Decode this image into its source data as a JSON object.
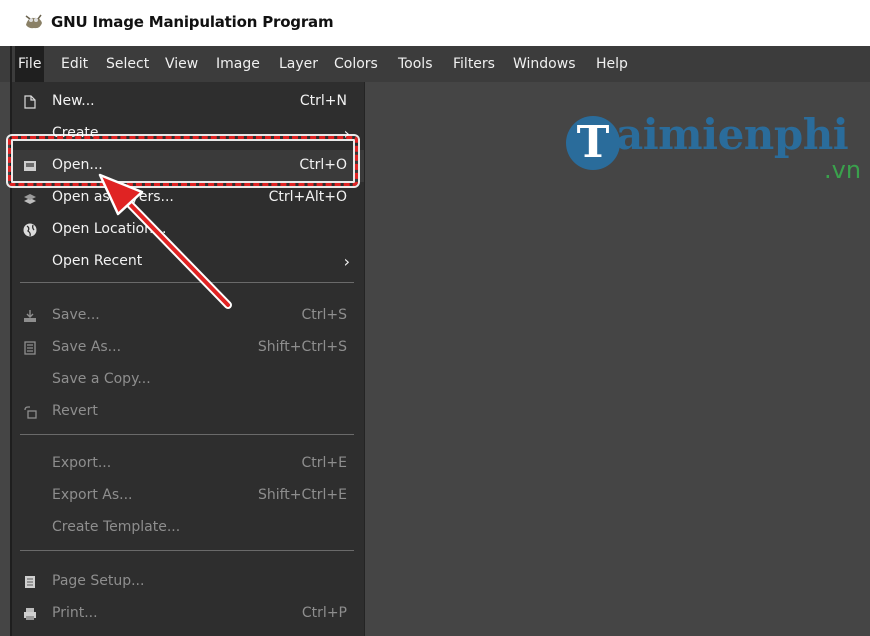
{
  "window": {
    "title": "GNU Image Manipulation Program"
  },
  "menubar": {
    "items": [
      "File",
      "Edit",
      "Select",
      "View",
      "Image",
      "Layer",
      "Colors",
      "Tools",
      "Filters",
      "Windows",
      "Help"
    ],
    "active": "File"
  },
  "file_menu": {
    "new": {
      "label": "New...",
      "shortcut": "Ctrl+N",
      "icon": "new-document-icon"
    },
    "create": {
      "label": "Create"
    },
    "open": {
      "label": "Open...",
      "shortcut": "Ctrl+O",
      "icon": "open-folder-icon"
    },
    "open_as_layers": {
      "label": "Open as Layers...",
      "shortcut": "Ctrl+Alt+O",
      "icon": "open-as-layers-icon"
    },
    "open_location": {
      "label": "Open Location...",
      "icon": "globe-icon"
    },
    "open_recent": {
      "label": "Open Recent"
    },
    "save": {
      "label": "Save...",
      "shortcut": "Ctrl+S",
      "icon": "save-icon"
    },
    "save_as": {
      "label": "Save As...",
      "shortcut": "Shift+Ctrl+S",
      "icon": "save-as-icon"
    },
    "save_copy": {
      "label": "Save a Copy..."
    },
    "revert": {
      "label": "Revert",
      "icon": "revert-icon"
    },
    "export": {
      "label": "Export...",
      "shortcut": "Ctrl+E"
    },
    "export_as": {
      "label": "Export As...",
      "shortcut": "Shift+Ctrl+E"
    },
    "create_template": {
      "label": "Create Template..."
    },
    "page_setup": {
      "label": "Page Setup...",
      "icon": "page-setup-icon"
    },
    "print": {
      "label": "Print...",
      "shortcut": "Ctrl+P",
      "icon": "printer-icon"
    }
  },
  "watermark": {
    "letter": "T",
    "text": "aimienphi",
    "suffix": ".vn"
  },
  "colors": {
    "highlight": "#e02323",
    "menu_bg": "#2e2e2e",
    "canvas_bg": "#454545",
    "watermark_blue": "#2a6c9b",
    "watermark_green": "#3aa14c"
  }
}
